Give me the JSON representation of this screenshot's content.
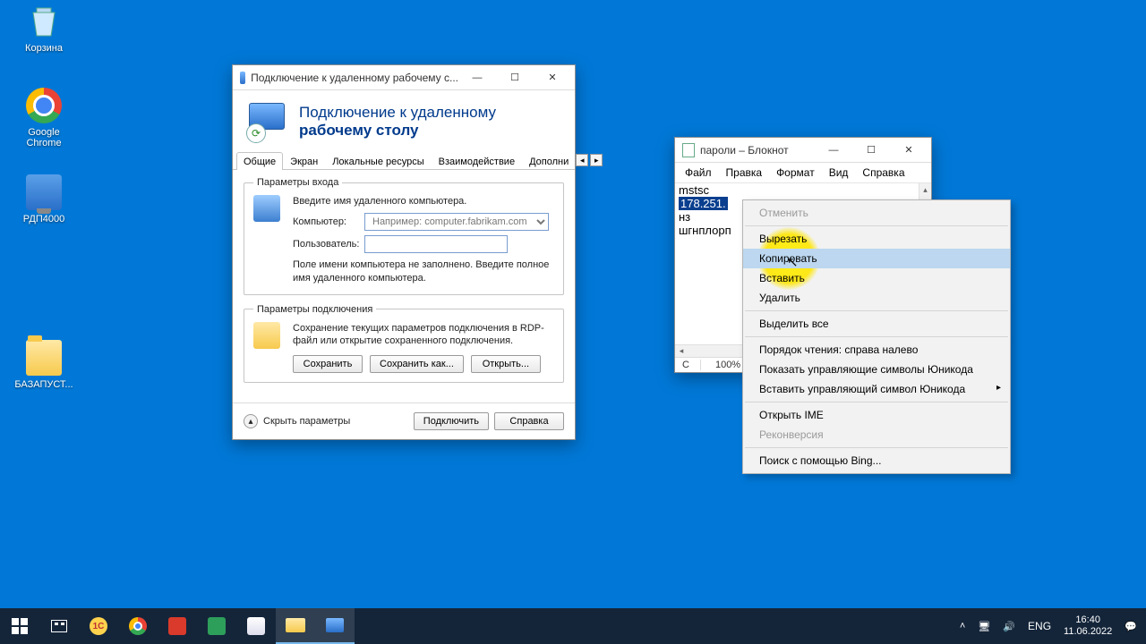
{
  "desktop": {
    "recycle_label": "Корзина",
    "chrome_label": "Google Chrome",
    "rdp4000_label": "РДП4000",
    "folder_label": "БАЗАПУСТ..."
  },
  "mstsc": {
    "title": "Подключение к удаленному рабочему с...",
    "banner_line1": "Подключение к удаленному",
    "banner_line2": "рабочему столу",
    "tabs": {
      "general": "Общие",
      "display": "Экран",
      "local": "Локальные ресурсы",
      "experience": "Взаимодействие",
      "advanced": "Дополни"
    },
    "logon_group": "Параметры входа",
    "logon_hint": "Введите имя удаленного компьютера.",
    "computer_label": "Компьютер:",
    "computer_placeholder": "Например: computer.fabrikam.com",
    "user_label": "Пользователь:",
    "user_value": "",
    "empty_hint": "Поле имени компьютера не заполнено. Введите полное имя удаленного компьютера.",
    "conn_group": "Параметры подключения",
    "conn_hint": "Сохранение текущих параметров подключения в RDP-файл или открытие сохраненного подключения.",
    "save": "Сохранить",
    "save_as": "Сохранить как...",
    "open": "Открыть...",
    "hide_params": "Скрыть параметры",
    "connect": "Подключить",
    "help": "Справка"
  },
  "notepad": {
    "title": "пароли – Блокнот",
    "menu": {
      "file": "Файл",
      "edit": "Правка",
      "format": "Формат",
      "view": "Вид",
      "help": "Справка"
    },
    "line1": "mstsc",
    "line2_selected": "178.251.",
    "line3": "нз",
    "line4": "шгнплорп",
    "status_caret": "С",
    "status_zoom": "100%"
  },
  "context_menu": {
    "undo": "Отменить",
    "cut": "Вырезать",
    "copy": "Копировать",
    "paste": "Вставить",
    "delete": "Удалить",
    "select_all": "Выделить все",
    "rtl": "Порядок чтения: справа налево",
    "show_unicode": "Показать управляющие символы Юникода",
    "insert_unicode": "Вставить управляющий символ Юникода",
    "open_ime": "Открыть IME",
    "reconvert": "Реконверсия",
    "bing": "Поиск с помощью Bing..."
  },
  "taskbar": {
    "lang": "ENG",
    "time": "16:40",
    "date": "11.06.2022"
  }
}
